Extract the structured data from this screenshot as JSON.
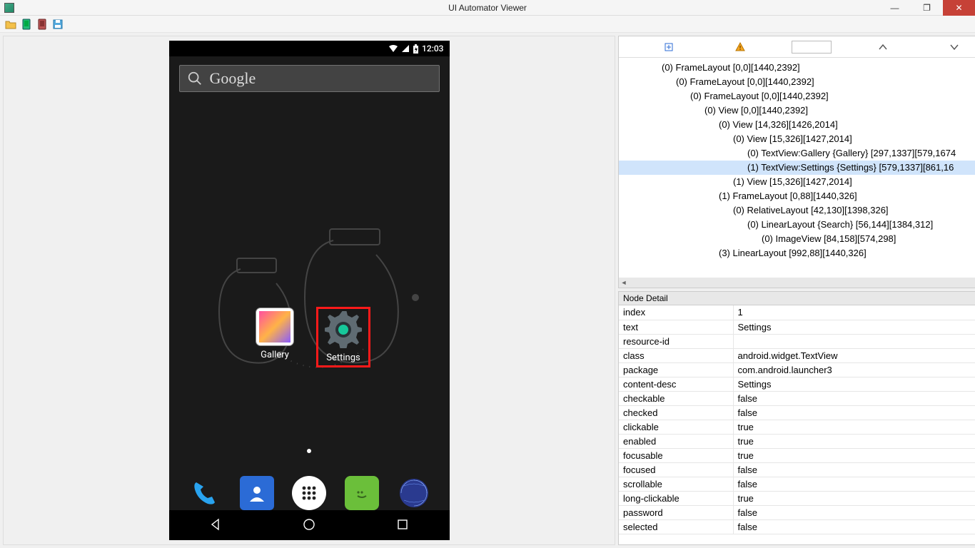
{
  "window": {
    "title": "UI Automator Viewer"
  },
  "phone": {
    "time": "12:03",
    "search_hint": "Google",
    "gallery_label": "Gallery",
    "settings_label": "Settings"
  },
  "tree": {
    "filter": "",
    "rows": [
      {
        "indent": 60,
        "text": "(0) FrameLayout [0,0][1440,2392]",
        "sel": false
      },
      {
        "indent": 80,
        "text": "(0) FrameLayout [0,0][1440,2392]",
        "sel": false
      },
      {
        "indent": 100,
        "text": "(0) FrameLayout [0,0][1440,2392]",
        "sel": false
      },
      {
        "indent": 120,
        "text": "(0) View [0,0][1440,2392]",
        "sel": false
      },
      {
        "indent": 140,
        "text": "(0) View [14,326][1426,2014]",
        "sel": false
      },
      {
        "indent": 160,
        "text": "(0) View [15,326][1427,2014]",
        "sel": false
      },
      {
        "indent": 180,
        "text": "(0) TextView:Gallery {Gallery} [297,1337][579,1674",
        "sel": false
      },
      {
        "indent": 180,
        "text": "(1) TextView:Settings {Settings} [579,1337][861,16",
        "sel": true
      },
      {
        "indent": 160,
        "text": "(1) View [15,326][1427,2014]",
        "sel": false
      },
      {
        "indent": 140,
        "text": "(1) FrameLayout [0,88][1440,326]",
        "sel": false
      },
      {
        "indent": 160,
        "text": "(0) RelativeLayout [42,130][1398,326]",
        "sel": false
      },
      {
        "indent": 180,
        "text": "(0) LinearLayout {Search} [56,144][1384,312]",
        "sel": false
      },
      {
        "indent": 200,
        "text": "(0) ImageView [84,158][574,298]",
        "sel": false
      },
      {
        "indent": 140,
        "text": "(3) LinearLayout [992,88][1440,326]",
        "sel": false
      }
    ]
  },
  "detail": {
    "title": "Node Detail",
    "rows": [
      {
        "k": "index",
        "v": "1"
      },
      {
        "k": "text",
        "v": "Settings"
      },
      {
        "k": "resource-id",
        "v": ""
      },
      {
        "k": "class",
        "v": "android.widget.TextView"
      },
      {
        "k": "package",
        "v": "com.android.launcher3"
      },
      {
        "k": "content-desc",
        "v": "Settings"
      },
      {
        "k": "checkable",
        "v": "false"
      },
      {
        "k": "checked",
        "v": "false"
      },
      {
        "k": "clickable",
        "v": "true"
      },
      {
        "k": "enabled",
        "v": "true"
      },
      {
        "k": "focusable",
        "v": "true"
      },
      {
        "k": "focused",
        "v": "false"
      },
      {
        "k": "scrollable",
        "v": "false"
      },
      {
        "k": "long-clickable",
        "v": "true"
      },
      {
        "k": "password",
        "v": "false"
      },
      {
        "k": "selected",
        "v": "false"
      }
    ]
  }
}
